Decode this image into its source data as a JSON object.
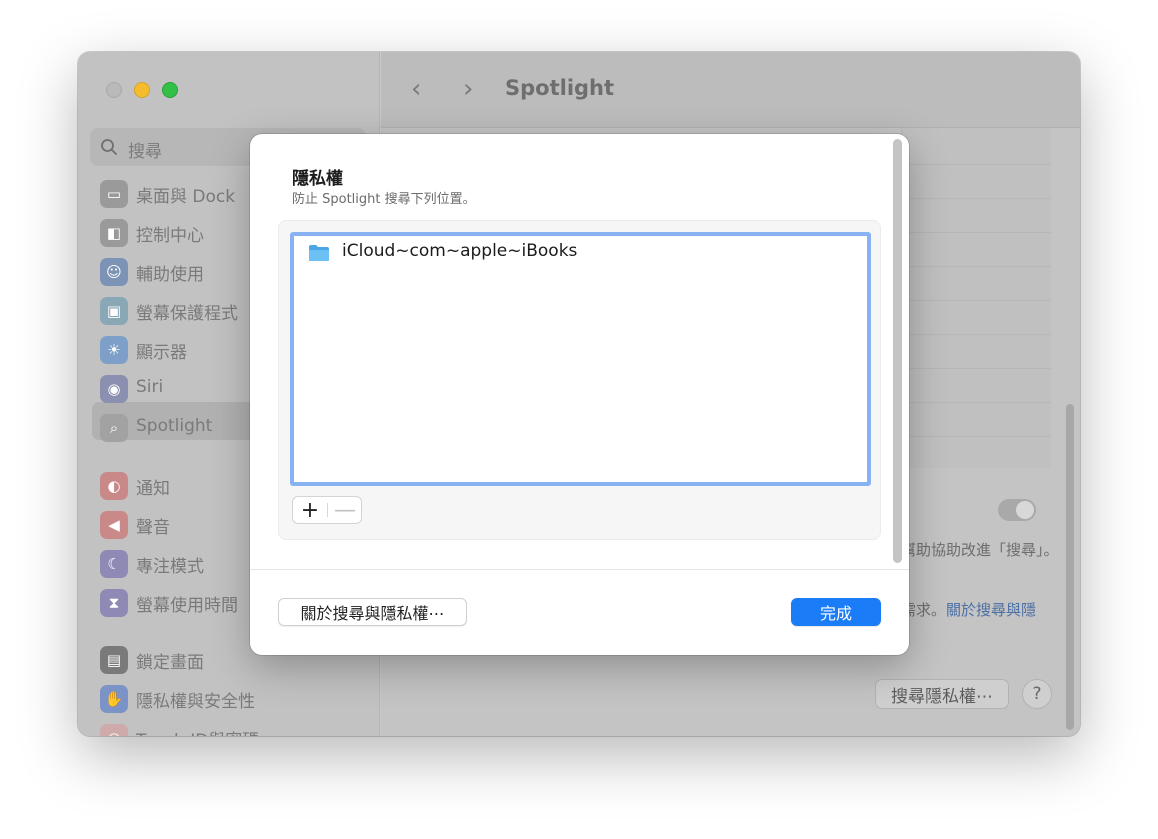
{
  "window": {
    "title": "Spotlight",
    "nav_back": "‹",
    "nav_forward": "›"
  },
  "sidebar": {
    "search_placeholder": "搜尋",
    "selected": "Spotlight",
    "items": [
      {
        "label": "桌面與 Dock",
        "icon": "dock-icon",
        "color": "#9a9a9a"
      },
      {
        "label": "控制中心",
        "icon": "control-center-icon",
        "color": "#9a9a9a"
      },
      {
        "label": "輔助使用",
        "icon": "accessibility-icon",
        "color": "#7d93b5"
      },
      {
        "label": "螢幕保護程式",
        "icon": "screensaver-icon",
        "color": "#8aa7b6"
      },
      {
        "label": "顯示器",
        "icon": "display-icon",
        "color": "#7ea0c8"
      },
      {
        "label": "Siri",
        "icon": "siri-icon",
        "color": "#8b8fb0"
      },
      {
        "label": "Spotlight",
        "icon": "spotlight-icon",
        "color": "#a2a2a2"
      },
      {
        "label": "通知",
        "icon": "notifications-icon",
        "color": "#c98989"
      },
      {
        "label": "聲音",
        "icon": "sound-icon",
        "color": "#c98989"
      },
      {
        "label": "專注模式",
        "icon": "focus-icon",
        "color": "#8e8ab5"
      },
      {
        "label": "螢幕使用時間",
        "icon": "screen-time-icon",
        "color": "#8e8ab5"
      },
      {
        "label": "鎖定畫面",
        "icon": "lock-screen-icon",
        "color": "#7a7a7a"
      },
      {
        "label": "隱私權與安全性",
        "icon": "privacy-hand-icon",
        "color": "#7b93c6"
      },
      {
        "label": "Touch ID與密碼",
        "icon": "touch-id-icon",
        "color": "#cfaaaa"
      }
    ]
  },
  "main": {
    "bg_text_1": "幫助協助改進「搜尋」。",
    "bg_text_2_prefix": "需求。",
    "bg_text_2_link": "關於搜尋與隱",
    "privacy_button": "搜尋隱私權⋯",
    "help_button": "?"
  },
  "sheet": {
    "title": "隱私權",
    "subtitle": "防止 Spotlight 搜尋下列位置。",
    "list_items": [
      {
        "name": "iCloud~com~apple~iBooks",
        "icon": "folder-icon"
      }
    ],
    "add_button": "+",
    "remove_button": "—",
    "about_button": "關於搜尋與隱私權⋯",
    "done_button": "完成"
  },
  "colors": {
    "accent": "#1a7cf7",
    "list_focus_ring": "#88b2f1",
    "traffic_min": "#f5bd2d",
    "traffic_max": "#32c046"
  }
}
